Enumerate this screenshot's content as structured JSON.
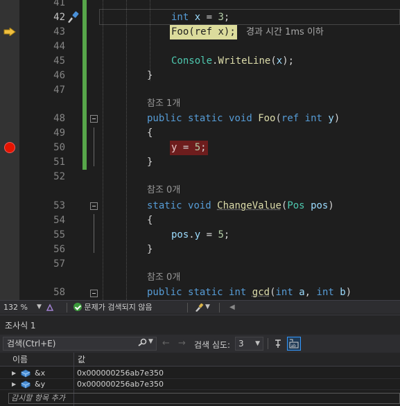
{
  "editor": {
    "lines": [
      {
        "num": "41",
        "text": ""
      },
      {
        "num": "42",
        "text": "int x = 3;"
      },
      {
        "num": "43",
        "text": "Foo(ref x);"
      },
      {
        "num": "44",
        "text": ""
      },
      {
        "num": "45",
        "text": "Console.WriteLine(x);"
      },
      {
        "num": "46",
        "text": "}"
      },
      {
        "num": "47",
        "text": ""
      },
      {
        "num": "48",
        "text": "public static void Foo(ref int y)"
      },
      {
        "num": "49",
        "text": "{"
      },
      {
        "num": "50",
        "text": "y = 5;"
      },
      {
        "num": "51",
        "text": "}"
      },
      {
        "num": "52",
        "text": ""
      },
      {
        "num": "53",
        "text": "static void ChangeValue(Pos pos)"
      },
      {
        "num": "54",
        "text": "{"
      },
      {
        "num": "55",
        "text": "pos.y = 5;"
      },
      {
        "num": "56",
        "text": "}"
      },
      {
        "num": "57",
        "text": ""
      },
      {
        "num": "58",
        "text": "public static int gcd(int a, int b)"
      }
    ],
    "perf_tip": "경과 시간 1ms 이하",
    "ref_1": "참조 1개",
    "ref_0a": "참조 0개",
    "ref_0b": "참조 0개",
    "colors": {
      "breakpoint": "#e51400",
      "current_statement": "#dcdc9c",
      "change_bar": "#57a64a",
      "arrow": "#f0c040"
    }
  },
  "statusbar": {
    "zoom": "132 %",
    "issues": "문제가 검색되지 않음"
  },
  "watch": {
    "title": "조사식 1",
    "search_placeholder": "검색(Ctrl+E)",
    "depth_label": "검색 심도:",
    "depth_value": "3",
    "columns": {
      "name": "이름",
      "value": "값"
    },
    "rows": [
      {
        "name": "&x",
        "value": "0x000000256ab7e350"
      },
      {
        "name": "&y",
        "value": "0x000000256ab7e350"
      }
    ],
    "add_item": "감시할 항목 추가"
  }
}
